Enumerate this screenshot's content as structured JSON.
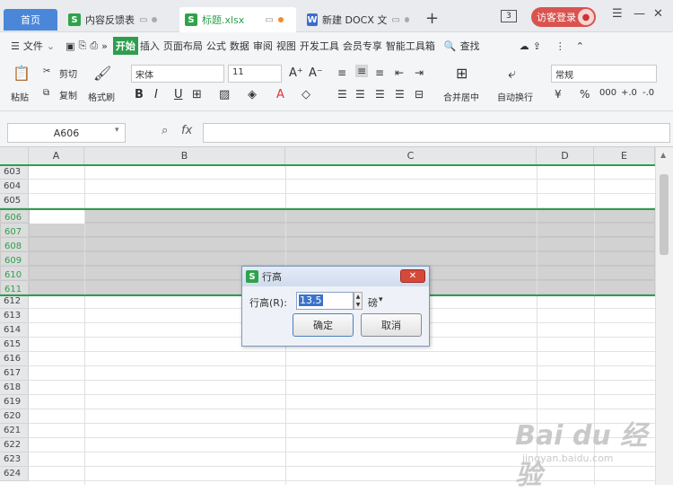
{
  "tabs": {
    "home": "首页",
    "t1": "内容反馈表",
    "t2": "标题.xlsx",
    "t3": "新建 DOCX 文"
  },
  "tab_icon_s": "S",
  "tab_icon_w": "W",
  "header": {
    "badge": "3",
    "login": "访客登录"
  },
  "menu": [
    "文件",
    "开始",
    "插入",
    "页面布局",
    "公式",
    "数据",
    "审阅",
    "视图",
    "开发工具",
    "会员专享",
    "智能工具箱"
  ],
  "menu_search": "查找",
  "ribbon": {
    "paste": "粘贴",
    "cut": "剪切",
    "copy": "复制",
    "format_painter": "格式刷",
    "font": "宋体",
    "size": "11",
    "merge": "合并居中",
    "wrap": "自动换行",
    "number_format": "常规"
  },
  "namebox": "A606",
  "fx": "fx",
  "columns": [
    "A",
    "B",
    "C",
    "D",
    "E"
  ],
  "rows": [
    "603",
    "604",
    "605",
    "606",
    "607",
    "608",
    "609",
    "610",
    "611",
    "612",
    "613",
    "614",
    "615",
    "616",
    "617",
    "618",
    "619",
    "620",
    "621",
    "622",
    "623",
    "624"
  ],
  "selected_rows": [
    "606",
    "607",
    "608",
    "609",
    "610",
    "611"
  ],
  "dialog": {
    "title": "行高",
    "label": "行高(R):",
    "value": "13.5",
    "unit": "磅",
    "ok": "确定",
    "cancel": "取消"
  },
  "watermark": {
    "main": "Bai du 经验",
    "sub": "jingyan.baidu.com"
  }
}
